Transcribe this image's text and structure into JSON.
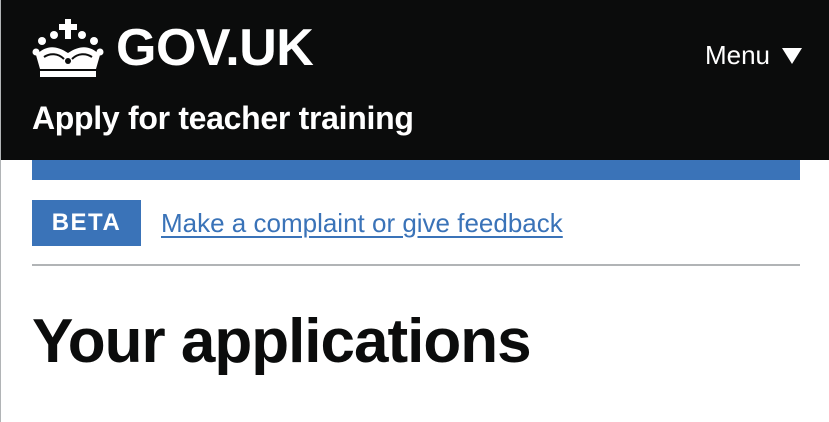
{
  "header": {
    "logo_text": "GOV.UK",
    "crown_icon": "crown-icon",
    "menu_label": "Menu",
    "menu_icon": "triangle-down-icon",
    "service_name": "Apply for teacher training",
    "background_color": "#0b0c0c"
  },
  "phase_banner": {
    "tag": "BETA",
    "link_text": "Make a complaint or give feedback",
    "accent_color": "#3a73b8"
  },
  "main": {
    "title": "Your applications"
  }
}
